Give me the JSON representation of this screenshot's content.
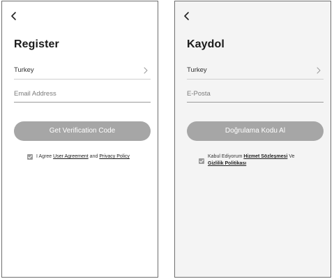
{
  "english": {
    "title": "Register",
    "country": "Turkey",
    "email_placeholder": "Email Address",
    "verify_button": "Get Verification Code",
    "agree_prefix": "I Agree ",
    "agreement_link": "User Agreement",
    "agree_and": " and ",
    "privacy_link": "Privacy Policy",
    "icons": [
      "back-icon",
      "chevron-right-icon",
      "checkbox-checked-icon"
    ]
  },
  "turkish": {
    "title": "Kaydol",
    "country": "Turkey",
    "email_placeholder": "E-Posta",
    "verify_button": "Doğrulama Kodu Al",
    "agree_prefix": "Kabul Ediyorum ",
    "agreement_link": "Hizmet Sözleşmesi",
    "agree_and": " Ve ",
    "privacy_link": "Gizlilik Politikası",
    "icons": [
      "back-icon",
      "chevron-right-icon",
      "checkbox-checked-icon"
    ]
  },
  "colors": {
    "button_bg": "#a6a6a6",
    "button_text": "#ffffff",
    "checkbox": "#9a9a9a",
    "right_screen_bg": "#f4f4f4"
  }
}
